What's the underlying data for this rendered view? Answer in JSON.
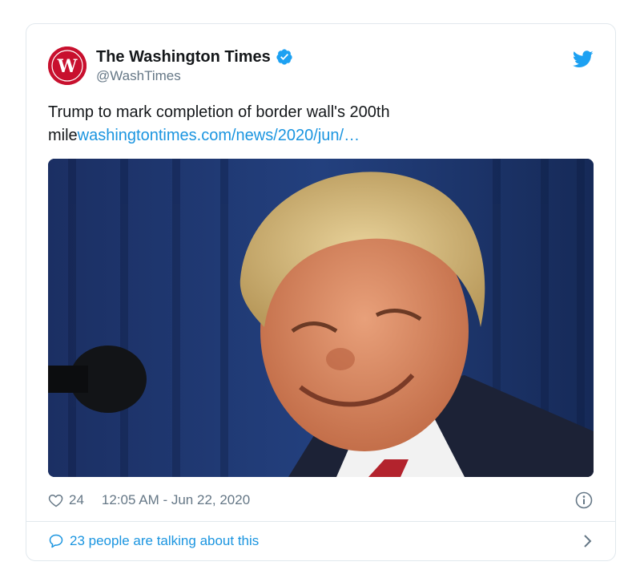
{
  "account": {
    "display_name": "The Washington Times",
    "handle": "@WashTimes",
    "avatar_icon": "washington-times-logo",
    "verified": true
  },
  "tweet": {
    "text": "Trump to mark completion of border wall's 200th mile",
    "link_text": "washingtontimes.com/news/2020/jun/…"
  },
  "media": {
    "description_icon": "photo"
  },
  "meta": {
    "likes": "24",
    "timestamp": "12:05 AM - Jun 22, 2020"
  },
  "footer": {
    "talking": "23 people are talking about this"
  },
  "colors": {
    "accent": "#1b95e0",
    "muted": "#657786",
    "border": "#e1e8ed",
    "logo_red": "#c8102e"
  }
}
